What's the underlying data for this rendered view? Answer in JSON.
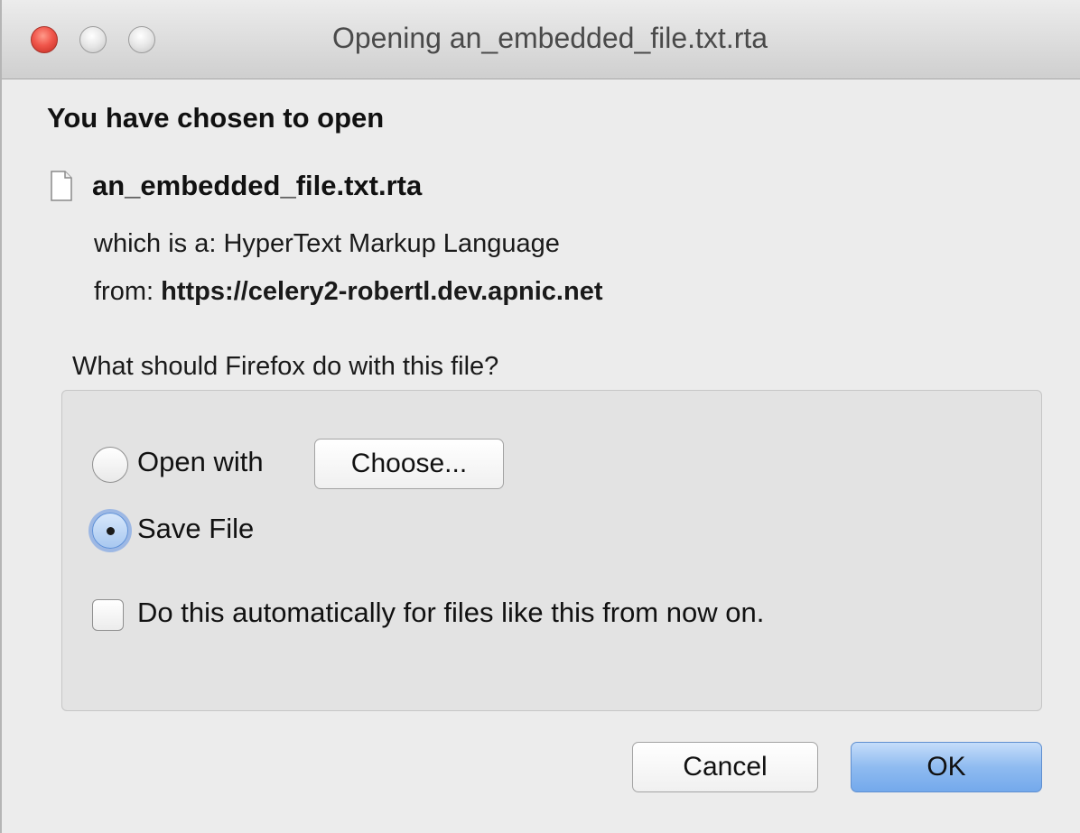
{
  "window": {
    "title": "Opening an_embedded_file.txt.rta",
    "controls": {
      "close_icon": "close-icon",
      "minimize_icon": "minimize-icon",
      "zoom_icon": "zoom-icon"
    }
  },
  "dialog": {
    "heading": "You have chosen to open",
    "file": {
      "icon": "file-icon",
      "name": "an_embedded_file.txt.rta"
    },
    "type_label": "which is a: ",
    "type_value": "HyperText Markup Language",
    "from_label": "from: ",
    "from_value": "https://celery2-robertl.dev.apnic.net",
    "question": "What should Firefox do with this file?",
    "options": {
      "open_with_label": "Open with",
      "open_with_selected": false,
      "choose_button_label": "Choose...",
      "save_file_label": "Save File",
      "save_file_selected": true,
      "auto_checkbox_label": "Do this automatically for files like this from now on.",
      "auto_checkbox_checked": false
    },
    "buttons": {
      "cancel_label": "Cancel",
      "ok_label": "OK"
    }
  },
  "colors": {
    "close_button": "#f0564b",
    "default_button": "#8fbbf0",
    "focus_ring": "#6496e6"
  }
}
